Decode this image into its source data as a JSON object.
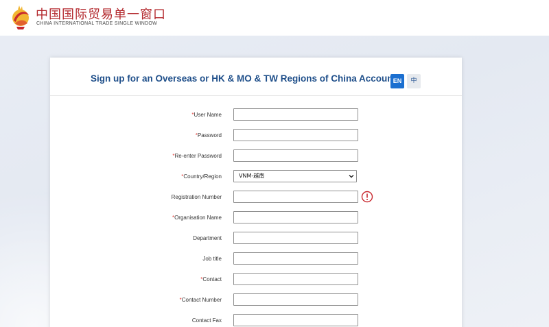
{
  "header": {
    "brand_cn": "中国国际贸易单一窗口",
    "brand_en": "CHINA INTERNATIONAL TRADE SINGLE WINDOW"
  },
  "form": {
    "title": "Sign up for an Overseas or HK & MO & TW Regions of China Account",
    "lang_en": "EN",
    "lang_zh": "中",
    "required_mark": "*",
    "fields": [
      {
        "label": "User Name",
        "required": true,
        "type": "text",
        "value": ""
      },
      {
        "label": "Password",
        "required": true,
        "type": "password",
        "value": ""
      },
      {
        "label": "Re-enter Password",
        "required": true,
        "type": "password",
        "value": ""
      },
      {
        "label": "Country/Region",
        "required": true,
        "type": "select",
        "value": "VNM-越南"
      },
      {
        "label": "Registration Number",
        "required": false,
        "type": "text",
        "value": "",
        "has_alert": true
      },
      {
        "label": "Organisation Name",
        "required": true,
        "type": "text",
        "value": ""
      },
      {
        "label": "Department",
        "required": false,
        "type": "text",
        "value": ""
      },
      {
        "label": "Job title",
        "required": false,
        "type": "text",
        "value": ""
      },
      {
        "label": "Contact",
        "required": true,
        "type": "text",
        "value": ""
      },
      {
        "label": "Contact Number",
        "required": true,
        "type": "text",
        "value": ""
      },
      {
        "label": "Contact Fax",
        "required": false,
        "type": "text",
        "value": ""
      }
    ]
  },
  "colors": {
    "title": "#1f4f8a",
    "active_lang": "#1b6fd0",
    "required": "#e0403a",
    "alert": "#c8282e",
    "brand": "#b3282d"
  },
  "icons": {
    "logo": "single-window-logo",
    "alert": "exclamation-circle-icon",
    "dropdown": "chevron-down-icon"
  }
}
